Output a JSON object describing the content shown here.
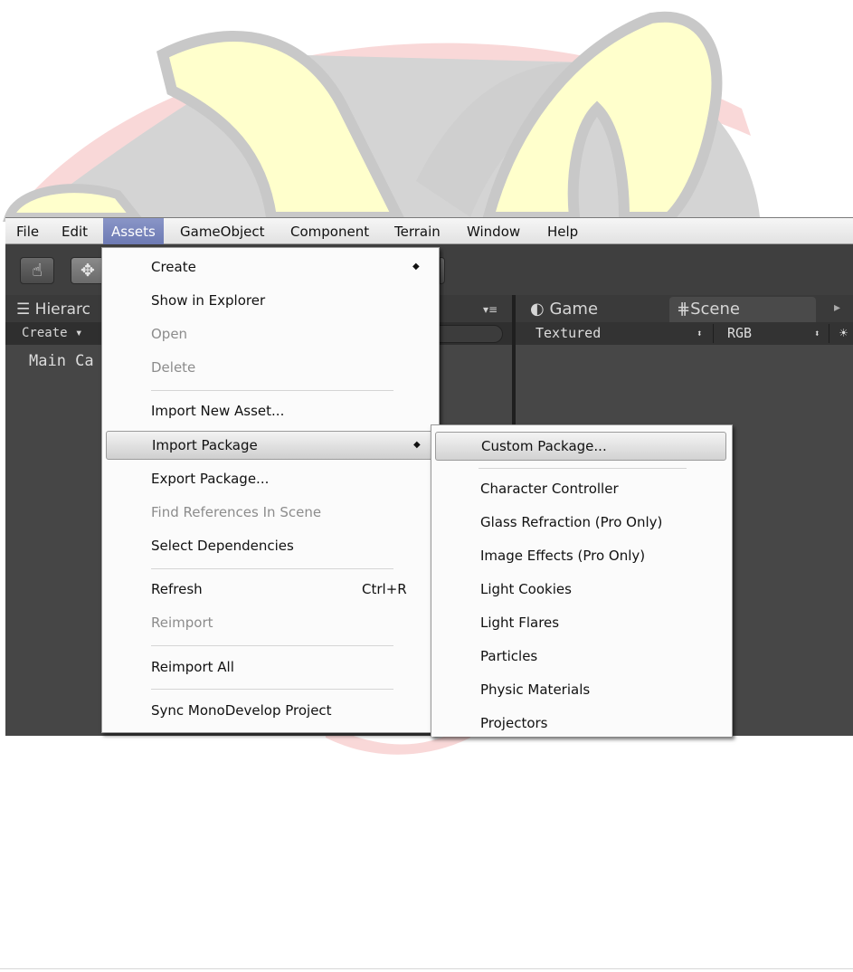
{
  "menubar": {
    "items": [
      "File",
      "Edit",
      "Assets",
      "GameObject",
      "Component",
      "Terrain",
      "Window",
      "Help"
    ],
    "active": "Assets"
  },
  "toolbar": {
    "tools": [
      {
        "icon": "hand-icon",
        "glyph": "☝"
      },
      {
        "icon": "move-icon",
        "glyph": "✥"
      }
    ]
  },
  "hierarchy": {
    "tab_label": "Hierarc",
    "create_label": "Create ▾",
    "items": [
      "Main Ca"
    ]
  },
  "view_tabs": {
    "game_label": "Game",
    "scene_label": "Scene"
  },
  "view_toolbar": {
    "shading_mode": "Textured",
    "render_mode": "RGB"
  },
  "assets_menu": {
    "items": [
      {
        "label": "Create",
        "submenu": true
      },
      {
        "label": "Show in Explorer"
      },
      {
        "label": "Open",
        "disabled": true
      },
      {
        "label": "Delete",
        "disabled": true
      },
      {
        "label": "Import New Asset..."
      },
      {
        "label": "Import Package",
        "submenu": true,
        "highlighted": true
      },
      {
        "label": "Export Package..."
      },
      {
        "label": "Find References In Scene",
        "disabled": true
      },
      {
        "label": "Select Dependencies"
      },
      {
        "label": "Refresh",
        "shortcut": "Ctrl+R"
      },
      {
        "label": "Reimport",
        "disabled": true
      },
      {
        "label": "Reimport All"
      },
      {
        "label": "Sync MonoDevelop Project"
      }
    ]
  },
  "import_package_submenu": {
    "items": [
      {
        "label": "Custom Package...",
        "highlighted": true
      },
      {
        "label": "Character Controller"
      },
      {
        "label": "Glass Refraction (Pro Only)"
      },
      {
        "label": "Image Effects (Pro Only)"
      },
      {
        "label": "Light Cookies"
      },
      {
        "label": "Light Flares"
      },
      {
        "label": "Particles"
      },
      {
        "label": "Physic Materials"
      },
      {
        "label": "Projectors"
      }
    ]
  },
  "colors": {
    "menu_highlight": "#7a86bd",
    "editor_bg": "#474747",
    "decor_yellow": "#ffffcc",
    "decor_gray": "#d4d4d4",
    "decor_pink": "#f7c8c8"
  }
}
